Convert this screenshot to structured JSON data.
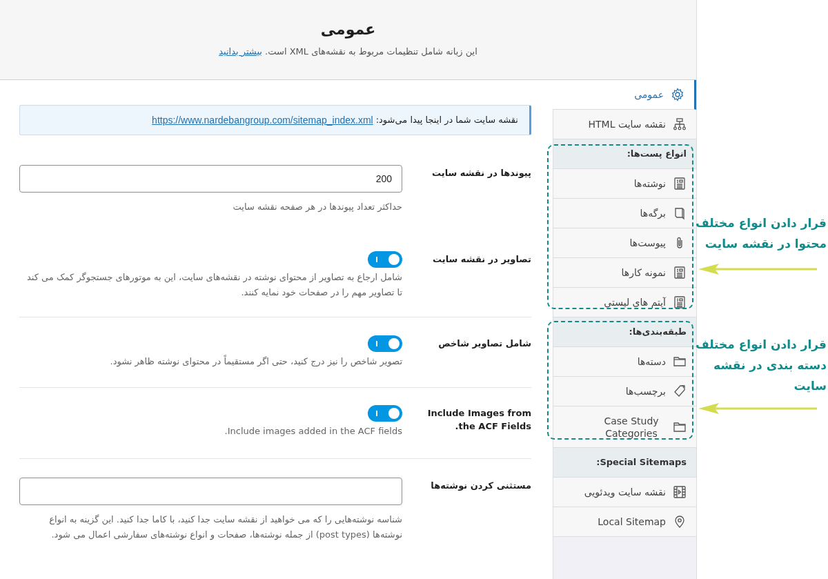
{
  "header": {
    "title": "عمومی",
    "description": "این زبانه شامل تنظیمات مربوط به نقشه‌های XML است.",
    "link": "بیشتر بدانید"
  },
  "notice": {
    "text": "نقشه سایت شما در اینجا پیدا می‌شود:",
    "link": "https://www.nardebangroup.com/sitemap_index.xml"
  },
  "settings": [
    {
      "kind": "number",
      "label": "پیوندها در نقشه سایت",
      "value": "200",
      "description": "حداکثر تعداد پیوندها در هر صفحه نقشه سایت"
    },
    {
      "kind": "toggle",
      "label": "تصاویر در نقشه سایت",
      "on": true,
      "description": "شامل ارجاع به تصاویر از محتوای نوشته در نقشه‌های سایت، این به موتورهای جستجوگر کمک می کند تا تصاویر مهم را در صفحات خود نمایه کنند."
    },
    {
      "kind": "toggle",
      "label": "شامل تصاویر شاخص",
      "on": true,
      "description": "تصویر شاخص را نیز درج کنید، حتی اگر مستقیماً در محتوای نوشته ظاهر نشود."
    },
    {
      "kind": "toggle",
      "label": "Include Images from the ACF Fields.",
      "on": true,
      "description": "Include images added in the ACF fields."
    },
    {
      "kind": "text",
      "label": "مستثنی کردن نوشته‌ها",
      "description": "شناسه نوشته‌هایی را که می خواهید از نقشه سایت جدا کنید، با کاما جدا کنید. این گزینه به انواع نوشته‌ها (post types) از جمله نوشته‌ها، صفحات و انواع نوشته‌های سفارشی اعمال می شود."
    }
  ],
  "sidebar": {
    "items": [
      {
        "kind": "item",
        "label": "عمومی",
        "selected": true
      },
      {
        "kind": "item",
        "label": "نقشه سایت HTML",
        "selected": false
      },
      {
        "kind": "heading",
        "label": "انواع پست‌ها:"
      },
      {
        "kind": "item",
        "label": "نوشته‌ها",
        "selected": false
      },
      {
        "kind": "item",
        "label": "برگه‌ها",
        "selected": false
      },
      {
        "kind": "item",
        "label": "پیوست‌ها",
        "selected": false
      },
      {
        "kind": "item",
        "label": "نمونه کارها",
        "selected": false
      },
      {
        "kind": "item",
        "label": "آیتم های لیستی",
        "selected": false
      },
      {
        "kind": "heading",
        "label": "طبقه‌بندی‌ها:"
      },
      {
        "kind": "item",
        "label": "دسته‌ها",
        "selected": false
      },
      {
        "kind": "item",
        "label": "برچسب‌ها",
        "selected": false
      },
      {
        "kind": "item",
        "label": "Case Study Categories",
        "selected": false
      },
      {
        "kind": "heading",
        "label": "Special Sitemaps:"
      },
      {
        "kind": "item",
        "label": "نقشه سایت ویدئویی",
        "selected": false
      },
      {
        "kind": "item",
        "label": "Local Sitemap",
        "selected": false
      }
    ]
  },
  "annotations": [
    {
      "lines": [
        "قرار دادن انواع مختلف",
        "محتوا در نقشه سایت"
      ]
    },
    {
      "lines": [
        "قرار دادن انواع مختلف",
        "دسته بندی در نقشه",
        "سایت"
      ]
    }
  ]
}
